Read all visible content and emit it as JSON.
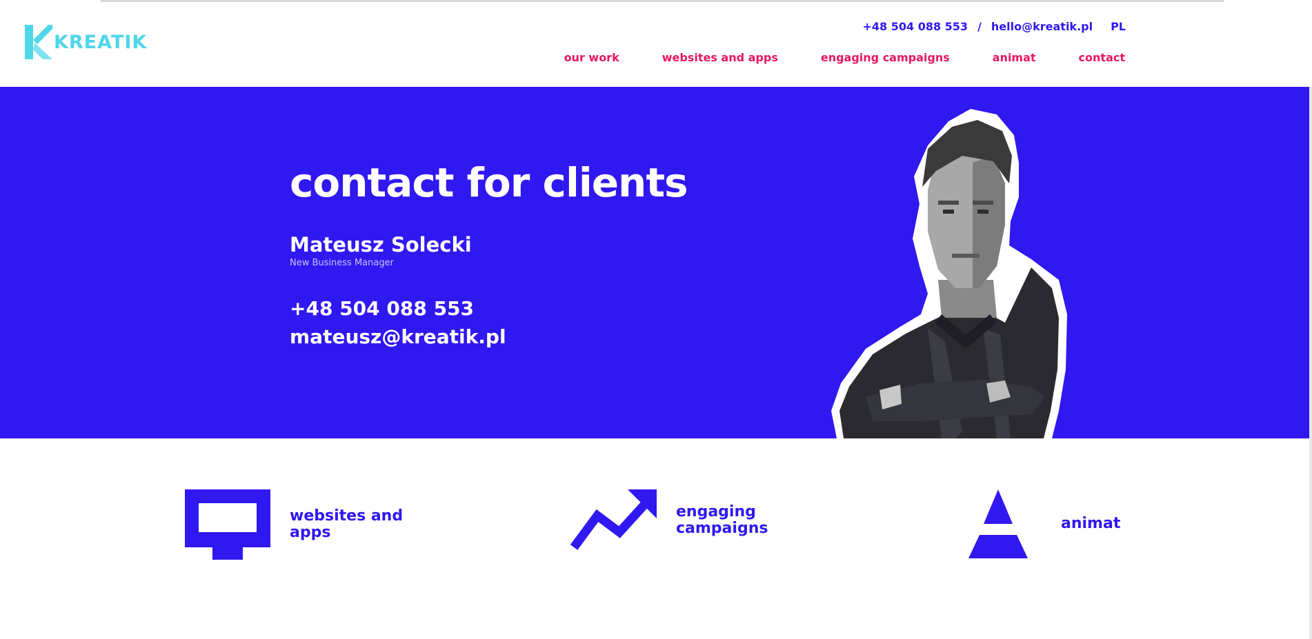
{
  "brand": {
    "name": "KREATIK",
    "logo_color": "#4fd6e8"
  },
  "header": {
    "phone": "+48 504 088 553",
    "separator": "/",
    "email": "hello@kreatik.pl",
    "language": "PL"
  },
  "nav": [
    {
      "label": "our work"
    },
    {
      "label": "websites and apps"
    },
    {
      "label": "engaging campaigns"
    },
    {
      "label": "animat"
    },
    {
      "label": "contact"
    }
  ],
  "hero": {
    "title": "contact for clients",
    "person_name": "Mateusz Solecki",
    "person_role": "New Business Manager",
    "phone": "+48 504 088 553",
    "email": "mateusz@kreatik.pl",
    "photo_icon": "person-photo"
  },
  "services": [
    {
      "label": "websites and apps",
      "icon": "monitor-icon"
    },
    {
      "label": "engaging campaigns",
      "icon": "trend-up-arrow-icon"
    },
    {
      "label": "animat",
      "icon": "animat-triangle-icon"
    }
  ],
  "colors": {
    "primary": "#3018f0",
    "accent": "#e8175d",
    "background": "#ffffff"
  }
}
